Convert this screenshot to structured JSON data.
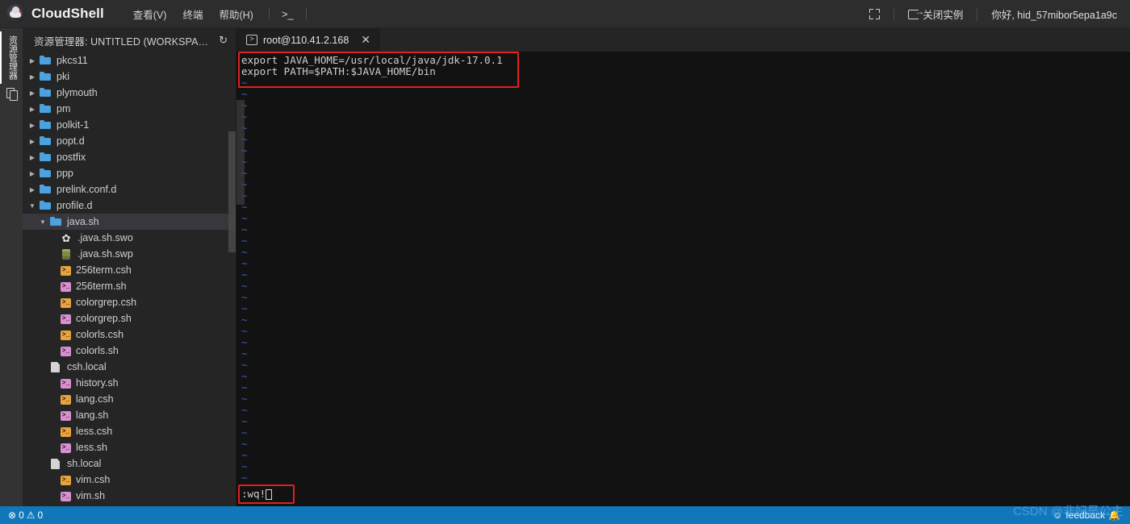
{
  "titlebar": {
    "brand": "CloudShell",
    "menus": [
      {
        "label": "查看(V)"
      },
      {
        "label": "终端"
      },
      {
        "label": "帮助(H)"
      }
    ],
    "terminal_icon_label": ">_",
    "maximize_label": "",
    "close_instance_label": "关闭实例",
    "greeting": "你好, hid_57mibor5epa1a9c"
  },
  "activitybar": {
    "explorer_label": "资源管理器"
  },
  "sidebar": {
    "header_title": "资源管理器: UNTITLED (WORKSPACE)",
    "refresh_glyph": "↻",
    "tree": [
      {
        "name": "pkcs11",
        "type": "folder",
        "state": "collapsed",
        "indent": 1
      },
      {
        "name": "pki",
        "type": "folder",
        "state": "collapsed",
        "indent": 1
      },
      {
        "name": "plymouth",
        "type": "folder",
        "state": "collapsed",
        "indent": 1
      },
      {
        "name": "pm",
        "type": "folder",
        "state": "collapsed",
        "indent": 1
      },
      {
        "name": "polkit-1",
        "type": "folder",
        "state": "collapsed",
        "indent": 1
      },
      {
        "name": "popt.d",
        "type": "folder",
        "state": "collapsed",
        "indent": 1
      },
      {
        "name": "postfix",
        "type": "folder",
        "state": "collapsed",
        "indent": 1
      },
      {
        "name": "ppp",
        "type": "folder",
        "state": "collapsed",
        "indent": 1
      },
      {
        "name": "prelink.conf.d",
        "type": "folder",
        "state": "collapsed",
        "indent": 1
      },
      {
        "name": "profile.d",
        "type": "folder",
        "state": "expanded",
        "indent": 1
      },
      {
        "name": "java.sh",
        "type": "folder",
        "state": "expanded",
        "indent": 2,
        "selected": true
      },
      {
        "name": ".java.sh.swo",
        "type": "gear",
        "state": "none",
        "indent": 3
      },
      {
        "name": ".java.sh.swp",
        "type": "db",
        "state": "none",
        "indent": 3
      },
      {
        "name": "256term.csh",
        "type": "csh",
        "state": "none",
        "indent": 3
      },
      {
        "name": "256term.sh",
        "type": "sh",
        "state": "none",
        "indent": 3
      },
      {
        "name": "colorgrep.csh",
        "type": "csh",
        "state": "none",
        "indent": 3
      },
      {
        "name": "colorgrep.sh",
        "type": "sh",
        "state": "none",
        "indent": 3
      },
      {
        "name": "colorls.csh",
        "type": "csh",
        "state": "none",
        "indent": 3
      },
      {
        "name": "colorls.sh",
        "type": "sh",
        "state": "none",
        "indent": 3
      },
      {
        "name": "csh.local",
        "type": "file",
        "state": "none",
        "indent": 2
      },
      {
        "name": "history.sh",
        "type": "sh",
        "state": "none",
        "indent": 3
      },
      {
        "name": "lang.csh",
        "type": "csh",
        "state": "none",
        "indent": 3
      },
      {
        "name": "lang.sh",
        "type": "sh",
        "state": "none",
        "indent": 3
      },
      {
        "name": "less.csh",
        "type": "csh",
        "state": "none",
        "indent": 3
      },
      {
        "name": "less.sh",
        "type": "sh",
        "state": "none",
        "indent": 3
      },
      {
        "name": "sh.local",
        "type": "file",
        "state": "none",
        "indent": 2
      },
      {
        "name": "vim.csh",
        "type": "csh",
        "state": "none",
        "indent": 3
      },
      {
        "name": "vim.sh",
        "type": "sh",
        "state": "none",
        "indent": 3
      }
    ]
  },
  "editor": {
    "tab": {
      "label": "root@110.41.2.168",
      "icon_glyph": ">",
      "close_glyph": "✕"
    }
  },
  "terminal": {
    "lines": [
      "export JAVA_HOME=/usr/local/java/jdk-17.0.1",
      "export PATH=$PATH:$JAVA_HOME/bin"
    ],
    "empty_marker": "~",
    "empty_line_count": 36,
    "command": ":wq!",
    "highlight_color": "#e02020",
    "background": "#121212",
    "tilde_color": "#3b5fbe"
  },
  "statusbar": {
    "error_glyph": "⊗",
    "error_count": "0",
    "warning_glyph": "⚠",
    "warning_count": "0",
    "feedback_label": "feedback",
    "feedback_glyph": "☺",
    "bell_glyph": "🔔",
    "background": "#1177bb"
  },
  "watermark": {
    "text": "CSDN @非妃是公主"
  }
}
